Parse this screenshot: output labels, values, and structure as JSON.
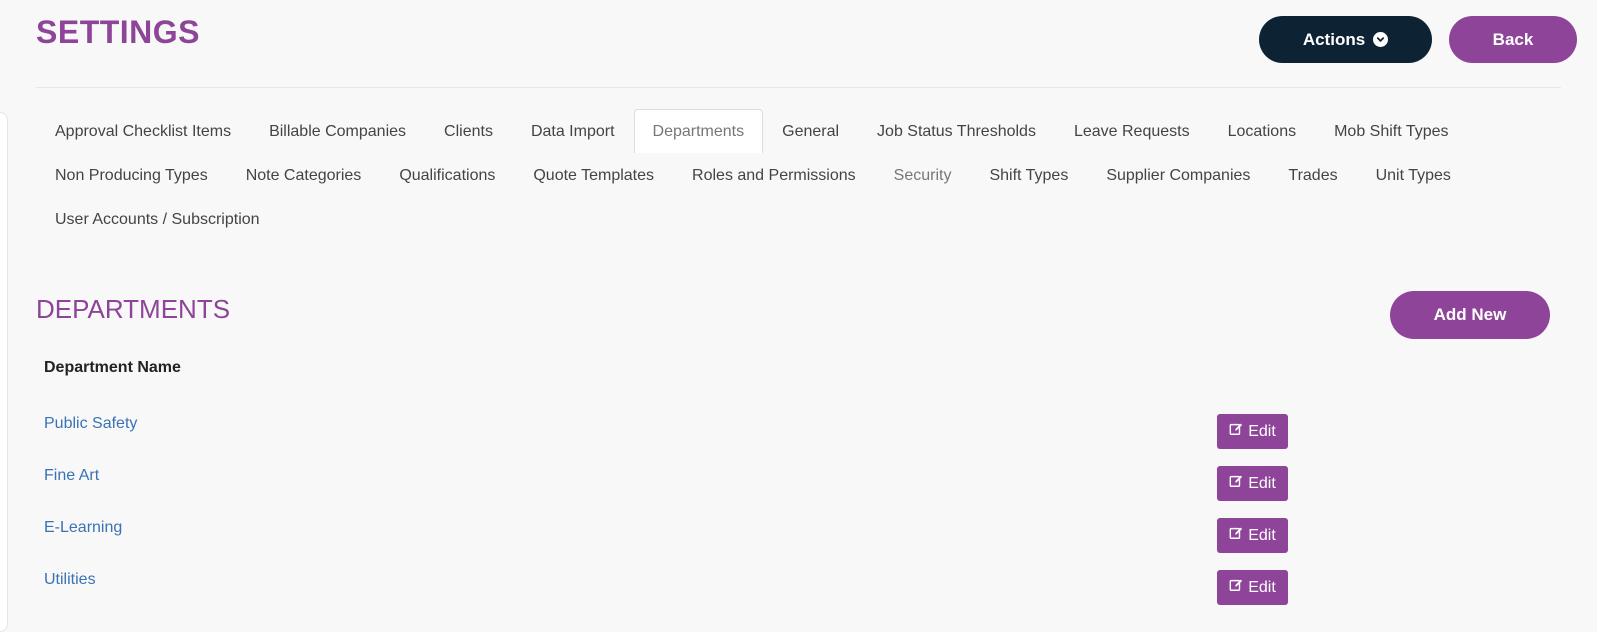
{
  "header": {
    "title": "SETTINGS",
    "actions_label": "Actions",
    "back_label": "Back"
  },
  "tabs": {
    "row1": [
      "Approval Checklist Items",
      "Billable Companies",
      "Clients",
      "Data Import",
      "Departments",
      "General",
      "Job Status Thresholds",
      "Leave Requests",
      "Locations",
      "Mob Shift Types"
    ],
    "row2": [
      "Non Producing Types",
      "Note Categories",
      "Qualifications",
      "Quote Templates",
      "Roles and Permissions",
      "Security",
      "Shift Types",
      "Supplier Companies",
      "Trades",
      "Unit Types"
    ],
    "row3": [
      "User Accounts / Subscription"
    ],
    "active": "Departments",
    "muted": "Security"
  },
  "section": {
    "title": "DEPARTMENTS",
    "add_label": "Add New",
    "column_header": "Department Name"
  },
  "departments": [
    {
      "name": "Public Safety",
      "edit_label": "Edit"
    },
    {
      "name": "Fine Art",
      "edit_label": "Edit"
    },
    {
      "name": "E-Learning",
      "edit_label": "Edit"
    },
    {
      "name": "Utilities",
      "edit_label": "Edit"
    }
  ],
  "colors": {
    "accent": "#8e4499",
    "dark_button": "#0d2333",
    "link": "#3a72b4",
    "background": "#f8f8f8"
  },
  "icons": {
    "actions": "chevron-down-circle-icon",
    "edit": "edit-icon"
  }
}
